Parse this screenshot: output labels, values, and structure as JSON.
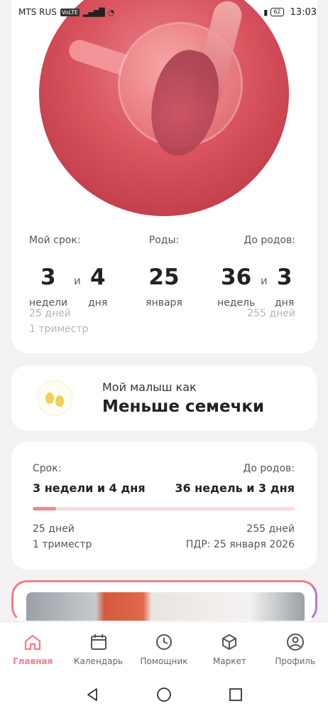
{
  "status_bar": {
    "carrier": "MTS RUS",
    "carrier_badge": "VoLTE",
    "signal": "▂▄▆█",
    "wifi": "◔",
    "vibrate": "▮",
    "battery": "62",
    "time": "13:03"
  },
  "hero": {
    "term_label": "Мой срок:",
    "weeks_value": "3",
    "weeks_unit": "недели",
    "and": "и",
    "days_value": "4",
    "days_unit": "дня",
    "birth_label": "Роды:",
    "birth_day": "25",
    "birth_month": "января",
    "until_label": "До родов:",
    "until_weeks_value": "36",
    "until_weeks_unit": "недель",
    "until_days_value": "3",
    "until_days_unit": "дня",
    "elapsed_days": "25 дней",
    "trimester": "1 триместр",
    "remaining_days": "255 дней"
  },
  "baby": {
    "label": "Мой малыш как",
    "size_name": "Меньше семечки"
  },
  "progress": {
    "term_label": "Срок:",
    "term_value": "3 недели и 4 дня",
    "until_label": "До родов:",
    "until_value": "36 недель и 3 дня",
    "fraction": 0.09,
    "elapsed_days": "25 дней",
    "trimester": "1 триместр",
    "remaining_days": "255 дней",
    "due_date": "ПДР: 25 января 2026"
  },
  "nav": {
    "items": [
      {
        "label": "Главная",
        "icon": "home-icon",
        "active": true
      },
      {
        "label": "Календарь",
        "icon": "calendar-icon",
        "active": false
      },
      {
        "label": "Помощник",
        "icon": "clock-icon",
        "active": false
      },
      {
        "label": "Маркет",
        "icon": "box-icon",
        "active": false
      },
      {
        "label": "Профиль",
        "icon": "user-circle-icon",
        "active": false
      }
    ]
  },
  "colors": {
    "accent": "#f07f8a",
    "progress_track": "#f9dde0",
    "background": "#f2f2f2"
  }
}
